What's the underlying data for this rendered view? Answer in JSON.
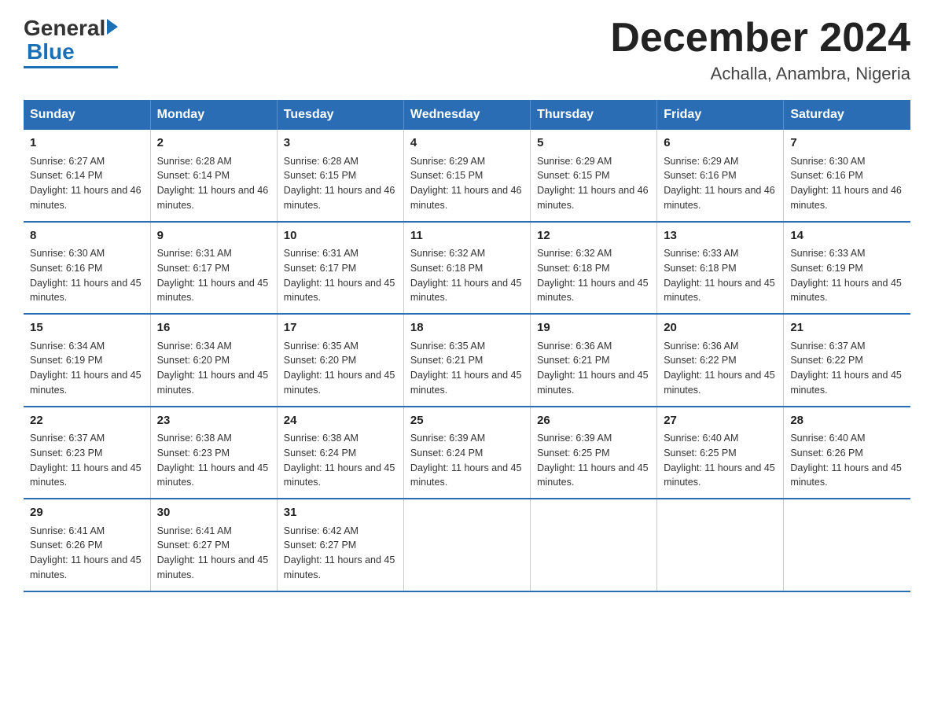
{
  "logo": {
    "general": "General",
    "blue": "Blue"
  },
  "header": {
    "title": "December 2024",
    "location": "Achalla, Anambra, Nigeria"
  },
  "weekdays": [
    "Sunday",
    "Monday",
    "Tuesday",
    "Wednesday",
    "Thursday",
    "Friday",
    "Saturday"
  ],
  "weeks": [
    [
      {
        "day": "1",
        "sunrise": "6:27 AM",
        "sunset": "6:14 PM",
        "daylight": "11 hours and 46 minutes."
      },
      {
        "day": "2",
        "sunrise": "6:28 AM",
        "sunset": "6:14 PM",
        "daylight": "11 hours and 46 minutes."
      },
      {
        "day": "3",
        "sunrise": "6:28 AM",
        "sunset": "6:15 PM",
        "daylight": "11 hours and 46 minutes."
      },
      {
        "day": "4",
        "sunrise": "6:29 AM",
        "sunset": "6:15 PM",
        "daylight": "11 hours and 46 minutes."
      },
      {
        "day": "5",
        "sunrise": "6:29 AM",
        "sunset": "6:15 PM",
        "daylight": "11 hours and 46 minutes."
      },
      {
        "day": "6",
        "sunrise": "6:29 AM",
        "sunset": "6:16 PM",
        "daylight": "11 hours and 46 minutes."
      },
      {
        "day": "7",
        "sunrise": "6:30 AM",
        "sunset": "6:16 PM",
        "daylight": "11 hours and 46 minutes."
      }
    ],
    [
      {
        "day": "8",
        "sunrise": "6:30 AM",
        "sunset": "6:16 PM",
        "daylight": "11 hours and 45 minutes."
      },
      {
        "day": "9",
        "sunrise": "6:31 AM",
        "sunset": "6:17 PM",
        "daylight": "11 hours and 45 minutes."
      },
      {
        "day": "10",
        "sunrise": "6:31 AM",
        "sunset": "6:17 PM",
        "daylight": "11 hours and 45 minutes."
      },
      {
        "day": "11",
        "sunrise": "6:32 AM",
        "sunset": "6:18 PM",
        "daylight": "11 hours and 45 minutes."
      },
      {
        "day": "12",
        "sunrise": "6:32 AM",
        "sunset": "6:18 PM",
        "daylight": "11 hours and 45 minutes."
      },
      {
        "day": "13",
        "sunrise": "6:33 AM",
        "sunset": "6:18 PM",
        "daylight": "11 hours and 45 minutes."
      },
      {
        "day": "14",
        "sunrise": "6:33 AM",
        "sunset": "6:19 PM",
        "daylight": "11 hours and 45 minutes."
      }
    ],
    [
      {
        "day": "15",
        "sunrise": "6:34 AM",
        "sunset": "6:19 PM",
        "daylight": "11 hours and 45 minutes."
      },
      {
        "day": "16",
        "sunrise": "6:34 AM",
        "sunset": "6:20 PM",
        "daylight": "11 hours and 45 minutes."
      },
      {
        "day": "17",
        "sunrise": "6:35 AM",
        "sunset": "6:20 PM",
        "daylight": "11 hours and 45 minutes."
      },
      {
        "day": "18",
        "sunrise": "6:35 AM",
        "sunset": "6:21 PM",
        "daylight": "11 hours and 45 minutes."
      },
      {
        "day": "19",
        "sunrise": "6:36 AM",
        "sunset": "6:21 PM",
        "daylight": "11 hours and 45 minutes."
      },
      {
        "day": "20",
        "sunrise": "6:36 AM",
        "sunset": "6:22 PM",
        "daylight": "11 hours and 45 minutes."
      },
      {
        "day": "21",
        "sunrise": "6:37 AM",
        "sunset": "6:22 PM",
        "daylight": "11 hours and 45 minutes."
      }
    ],
    [
      {
        "day": "22",
        "sunrise": "6:37 AM",
        "sunset": "6:23 PM",
        "daylight": "11 hours and 45 minutes."
      },
      {
        "day": "23",
        "sunrise": "6:38 AM",
        "sunset": "6:23 PM",
        "daylight": "11 hours and 45 minutes."
      },
      {
        "day": "24",
        "sunrise": "6:38 AM",
        "sunset": "6:24 PM",
        "daylight": "11 hours and 45 minutes."
      },
      {
        "day": "25",
        "sunrise": "6:39 AM",
        "sunset": "6:24 PM",
        "daylight": "11 hours and 45 minutes."
      },
      {
        "day": "26",
        "sunrise": "6:39 AM",
        "sunset": "6:25 PM",
        "daylight": "11 hours and 45 minutes."
      },
      {
        "day": "27",
        "sunrise": "6:40 AM",
        "sunset": "6:25 PM",
        "daylight": "11 hours and 45 minutes."
      },
      {
        "day": "28",
        "sunrise": "6:40 AM",
        "sunset": "6:26 PM",
        "daylight": "11 hours and 45 minutes."
      }
    ],
    [
      {
        "day": "29",
        "sunrise": "6:41 AM",
        "sunset": "6:26 PM",
        "daylight": "11 hours and 45 minutes."
      },
      {
        "day": "30",
        "sunrise": "6:41 AM",
        "sunset": "6:27 PM",
        "daylight": "11 hours and 45 minutes."
      },
      {
        "day": "31",
        "sunrise": "6:42 AM",
        "sunset": "6:27 PM",
        "daylight": "11 hours and 45 minutes."
      },
      null,
      null,
      null,
      null
    ]
  ]
}
